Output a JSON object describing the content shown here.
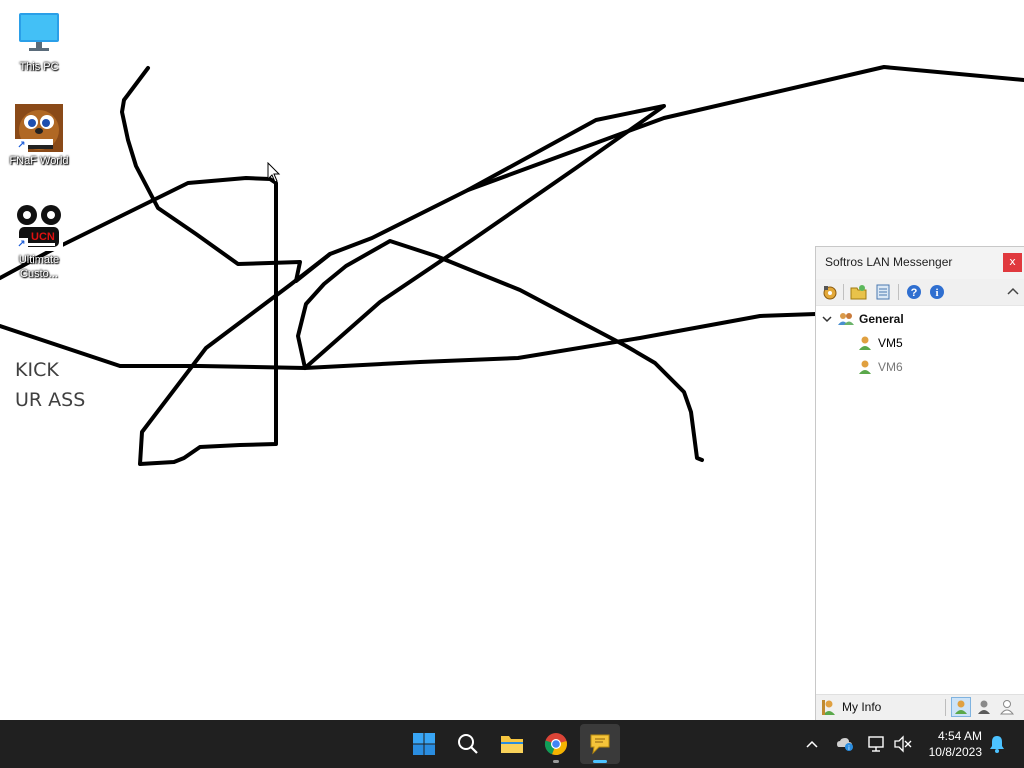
{
  "desktop": {
    "icons": [
      {
        "label": "This PC",
        "icon": "monitor-icon"
      },
      {
        "label": "FNaF World",
        "icon": "fnaf-world-icon"
      },
      {
        "label": "Ultimate\nCusto...",
        "icon": "ucn-icon",
        "badge": "UCN"
      }
    ],
    "text_line1": "KICK",
    "text_line2": "UR ASS"
  },
  "messenger": {
    "title": "Softros LAN Messenger",
    "close_label": "x",
    "group": {
      "name": "General",
      "expanded": true
    },
    "users": [
      {
        "name": "VM5",
        "status": "online",
        "color": "#000000"
      },
      {
        "name": "VM6",
        "status": "online",
        "color": "#777777"
      }
    ],
    "my_info_label": "My Info"
  },
  "taskbar": {
    "apps": [
      "start-icon",
      "search-icon",
      "file-explorer-icon",
      "chrome-icon",
      "softros-messenger-icon"
    ],
    "time": "4:54 AM",
    "date": "10/8/2023"
  },
  "colors": {
    "taskbar_bg": "#202020",
    "windows_blue": "#0078d4",
    "close_red": "#e0393e"
  }
}
